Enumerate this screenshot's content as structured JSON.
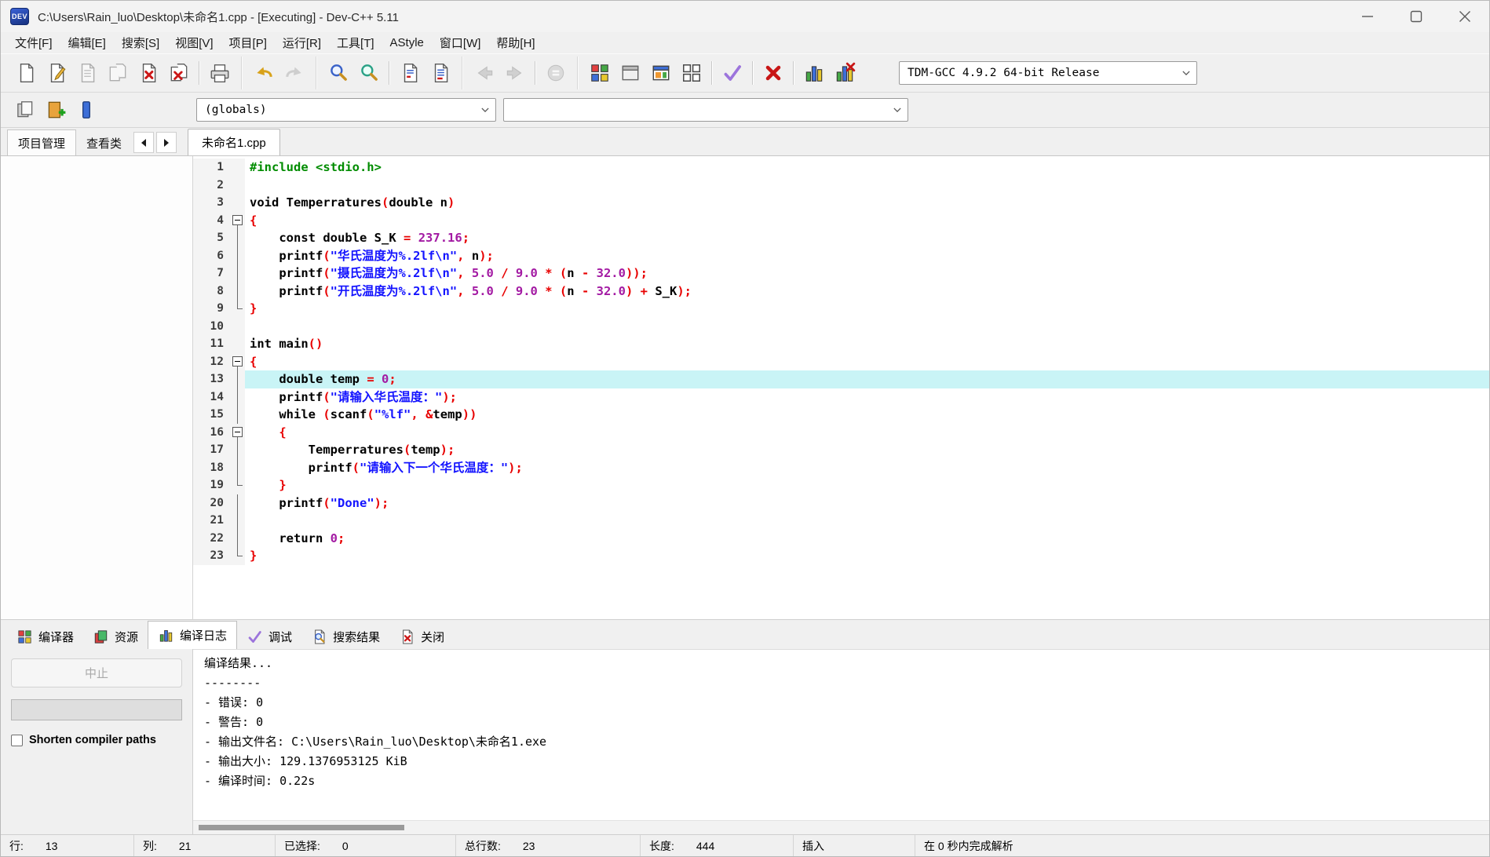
{
  "window": {
    "title": "C:\\Users\\Rain_luo\\Desktop\\未命名1.cpp - [Executing] - Dev-C++ 5.11",
    "logo_text": "DEV"
  },
  "menu": {
    "items": [
      "文件[F]",
      "编辑[E]",
      "搜索[S]",
      "视图[V]",
      "项目[P]",
      "运行[R]",
      "工具[T]",
      "AStyle",
      "窗口[W]",
      "帮助[H]"
    ]
  },
  "toolbar_main": {
    "compiler_value": "TDM-GCC 4.9.2 64-bit Release",
    "groups": [
      [
        {
          "n": "new-source",
          "i": "page"
        },
        {
          "n": "open",
          "i": "open"
        },
        {
          "n": "save",
          "i": "save",
          "d": 1
        },
        {
          "n": "save-all",
          "i": "save-all",
          "d": 1
        },
        {
          "n": "close",
          "i": "page-x"
        },
        {
          "n": "close-all",
          "i": "close-all"
        },
        "|",
        {
          "n": "print",
          "i": "printer"
        }
      ],
      [
        {
          "n": "undo",
          "i": "undo"
        },
        {
          "n": "redo",
          "i": "redo",
          "d": 1
        }
      ],
      [
        {
          "n": "find",
          "i": "find"
        },
        {
          "n": "find-in-files",
          "i": "find-files"
        },
        "|",
        {
          "n": "replace",
          "i": "replace"
        },
        {
          "n": "replace-all",
          "i": "replace-all"
        }
      ],
      [
        {
          "n": "goto-back",
          "i": "back",
          "d": 1
        },
        {
          "n": "goto-forward",
          "i": "forward",
          "d": 1
        },
        "|",
        {
          "n": "abort-compile",
          "i": "abort",
          "d": 1
        }
      ],
      [
        {
          "n": "compile",
          "i": "compile"
        },
        {
          "n": "run",
          "i": "run"
        },
        {
          "n": "compile-and-run",
          "i": "compile-run"
        },
        {
          "n": "rebuild-all",
          "i": "rebuild"
        },
        "|",
        {
          "n": "debug",
          "i": "check"
        },
        "|",
        {
          "n": "stop-execution",
          "i": "stop"
        },
        "|",
        {
          "n": "profile-analysis",
          "i": "chart"
        },
        {
          "n": "delete-profiling",
          "i": "chart-x"
        }
      ]
    ]
  },
  "toolbar_class": {
    "buttons": [
      {
        "n": "insert-snippet",
        "i": "insert"
      },
      {
        "n": "toggle-bookmark",
        "i": "bookmark-add"
      },
      {
        "n": "goto-bookmark",
        "i": "bookmark-goto"
      }
    ],
    "globals_value": "(globals)",
    "members_value": ""
  },
  "tabs": {
    "project_label": "项目管理",
    "classes_label": "查看类",
    "file_label": "未命名1.cpp"
  },
  "editor": {
    "highlight_line": 13,
    "lines": [
      {
        "n": 1,
        "f": "",
        "s": [
          [
            "p",
            "#include <stdio.h>"
          ]
        ]
      },
      {
        "n": 2,
        "f": "",
        "s": []
      },
      {
        "n": 3,
        "f": "",
        "s": [
          [
            "k",
            "void"
          ],
          [
            "d",
            " Temperratures"
          ],
          [
            "o",
            "("
          ],
          [
            "k",
            "double"
          ],
          [
            "d",
            " n"
          ],
          [
            "o",
            ")"
          ]
        ]
      },
      {
        "n": 4,
        "f": "box",
        "s": [
          [
            "o",
            "{"
          ]
        ]
      },
      {
        "n": 5,
        "f": "v",
        "s": [
          [
            "d",
            "    "
          ],
          [
            "k",
            "const"
          ],
          [
            "d",
            " "
          ],
          [
            "k",
            "double"
          ],
          [
            "d",
            " S_K "
          ],
          [
            "o",
            "="
          ],
          [
            "d",
            " "
          ],
          [
            "n",
            "237.16"
          ],
          [
            "o",
            ";"
          ]
        ]
      },
      {
        "n": 6,
        "f": "v",
        "s": [
          [
            "d",
            "    printf"
          ],
          [
            "o",
            "("
          ],
          [
            "s",
            "\"华氏温度为%.2lf\\n\""
          ],
          [
            "o",
            ","
          ],
          [
            "d",
            " n"
          ],
          [
            "o",
            ");"
          ]
        ]
      },
      {
        "n": 7,
        "f": "v",
        "s": [
          [
            "d",
            "    printf"
          ],
          [
            "o",
            "("
          ],
          [
            "s",
            "\"摄氏温度为%.2lf\\n\""
          ],
          [
            "o",
            ","
          ],
          [
            "d",
            " "
          ],
          [
            "n",
            "5.0"
          ],
          [
            "d",
            " "
          ],
          [
            "o",
            "/"
          ],
          [
            "d",
            " "
          ],
          [
            "n",
            "9.0"
          ],
          [
            "d",
            " "
          ],
          [
            "o",
            "*"
          ],
          [
            "d",
            " "
          ],
          [
            "o",
            "("
          ],
          [
            "d",
            "n "
          ],
          [
            "o",
            "-"
          ],
          [
            "d",
            " "
          ],
          [
            "n",
            "32.0"
          ],
          [
            "o",
            "));"
          ]
        ]
      },
      {
        "n": 8,
        "f": "v",
        "s": [
          [
            "d",
            "    printf"
          ],
          [
            "o",
            "("
          ],
          [
            "s",
            "\"开氏温度为%.2lf\\n\""
          ],
          [
            "o",
            ","
          ],
          [
            "d",
            " "
          ],
          [
            "n",
            "5.0"
          ],
          [
            "d",
            " "
          ],
          [
            "o",
            "/"
          ],
          [
            "d",
            " "
          ],
          [
            "n",
            "9.0"
          ],
          [
            "d",
            " "
          ],
          [
            "o",
            "*"
          ],
          [
            "d",
            " "
          ],
          [
            "o",
            "("
          ],
          [
            "d",
            "n "
          ],
          [
            "o",
            "-"
          ],
          [
            "d",
            " "
          ],
          [
            "n",
            "32.0"
          ],
          [
            "o",
            ")"
          ],
          [
            "d",
            " "
          ],
          [
            "o",
            "+"
          ],
          [
            "d",
            " S_K"
          ],
          [
            "o",
            ");"
          ]
        ]
      },
      {
        "n": 9,
        "f": "end",
        "s": [
          [
            "o",
            "}"
          ]
        ]
      },
      {
        "n": 10,
        "f": "",
        "s": []
      },
      {
        "n": 11,
        "f": "",
        "s": [
          [
            "k",
            "int"
          ],
          [
            "d",
            " main"
          ],
          [
            "o",
            "()"
          ]
        ]
      },
      {
        "n": 12,
        "f": "box",
        "s": [
          [
            "o",
            "{"
          ]
        ]
      },
      {
        "n": 13,
        "f": "v",
        "s": [
          [
            "d",
            "    "
          ],
          [
            "k",
            "double"
          ],
          [
            "d",
            " temp "
          ],
          [
            "o",
            "="
          ],
          [
            "d",
            " "
          ],
          [
            "n",
            "0"
          ],
          [
            "o",
            ";"
          ]
        ]
      },
      {
        "n": 14,
        "f": "v",
        "s": [
          [
            "d",
            "    printf"
          ],
          [
            "o",
            "("
          ],
          [
            "s",
            "\"请输入华氏温度：\""
          ],
          [
            "o",
            ");"
          ]
        ]
      },
      {
        "n": 15,
        "f": "v",
        "s": [
          [
            "d",
            "    "
          ],
          [
            "k",
            "while"
          ],
          [
            "d",
            " "
          ],
          [
            "o",
            "("
          ],
          [
            "d",
            "scanf"
          ],
          [
            "o",
            "("
          ],
          [
            "s",
            "\"%lf\""
          ],
          [
            "o",
            ","
          ],
          [
            "d",
            " "
          ],
          [
            "o",
            "&"
          ],
          [
            "d",
            "temp"
          ],
          [
            "o",
            "))"
          ]
        ]
      },
      {
        "n": 16,
        "f": "box",
        "s": [
          [
            "d",
            "    "
          ],
          [
            "o",
            "{"
          ]
        ]
      },
      {
        "n": 17,
        "f": "v",
        "s": [
          [
            "d",
            "        Temperratures"
          ],
          [
            "o",
            "("
          ],
          [
            "d",
            "temp"
          ],
          [
            "o",
            ");"
          ]
        ]
      },
      {
        "n": 18,
        "f": "v",
        "s": [
          [
            "d",
            "        printf"
          ],
          [
            "o",
            "("
          ],
          [
            "s",
            "\"请输入下一个华氏温度：\""
          ],
          [
            "o",
            ");"
          ]
        ]
      },
      {
        "n": 19,
        "f": "end",
        "s": [
          [
            "d",
            "    "
          ],
          [
            "o",
            "}"
          ]
        ]
      },
      {
        "n": 20,
        "f": "v",
        "s": [
          [
            "d",
            "    printf"
          ],
          [
            "o",
            "("
          ],
          [
            "s",
            "\"Done\""
          ],
          [
            "o",
            ");"
          ]
        ]
      },
      {
        "n": 21,
        "f": "v",
        "s": []
      },
      {
        "n": 22,
        "f": "v",
        "s": [
          [
            "d",
            "    "
          ],
          [
            "k",
            "return"
          ],
          [
            "d",
            " "
          ],
          [
            "n",
            "0"
          ],
          [
            "o",
            ";"
          ]
        ]
      },
      {
        "n": 23,
        "f": "end",
        "s": [
          [
            "o",
            "}"
          ]
        ]
      }
    ]
  },
  "bottom_tabs": [
    {
      "name": "tab-compiler",
      "label": "编译器",
      "icon": "compile"
    },
    {
      "name": "tab-resources",
      "label": "资源",
      "icon": "pages-color"
    },
    {
      "name": "tab-compile-log",
      "label": "编译日志",
      "icon": "chart",
      "active": 1
    },
    {
      "name": "tab-debug",
      "label": "调试",
      "icon": "check"
    },
    {
      "name": "tab-search-results",
      "label": "搜索结果",
      "icon": "page-mag"
    },
    {
      "name": "tab-close",
      "label": "关闭",
      "icon": "page-x"
    }
  ],
  "compile_panel": {
    "abort_label": "中止",
    "shorten_label": "Shorten compiler paths",
    "log_lines": [
      "编译结果...",
      "--------",
      "- 错误: 0",
      "- 警告: 0",
      "- 输出文件名: C:\\Users\\Rain_luo\\Desktop\\未命名1.exe",
      "- 输出大小: 129.1376953125 KiB",
      "- 编译时间: 0.22s"
    ]
  },
  "statusbar": {
    "items": [
      {
        "l": "行:",
        "v": "13"
      },
      {
        "l": "列:",
        "v": "21"
      },
      {
        "l": "已选择:",
        "v": "0"
      },
      {
        "l": "总行数:",
        "v": "23"
      },
      {
        "l": "长度:",
        "v": "444"
      },
      {
        "l": "插入"
      },
      {
        "l": "在 0 秒内完成解析"
      }
    ]
  }
}
